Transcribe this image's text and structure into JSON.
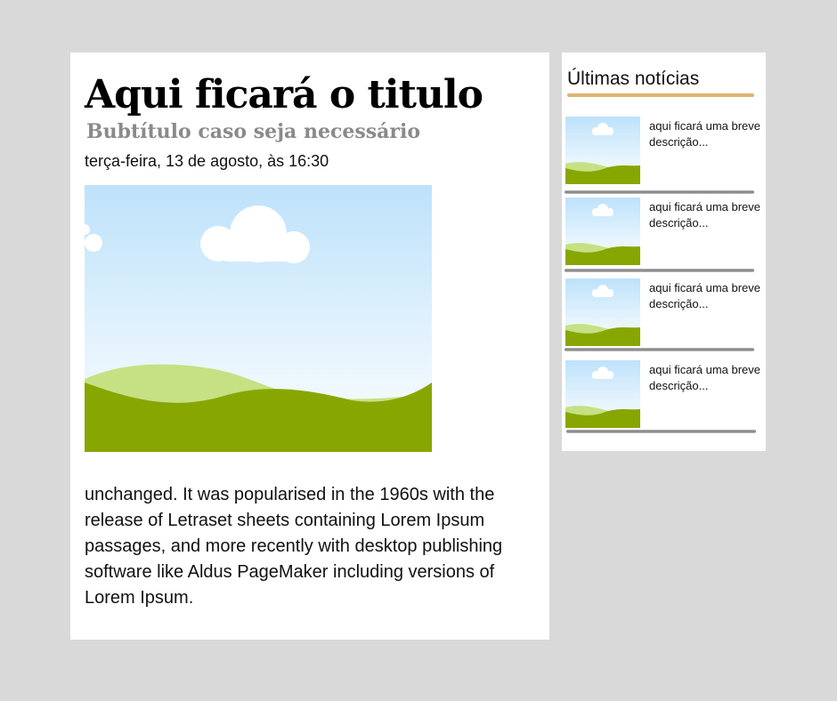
{
  "article": {
    "title": "Aqui ficará o titulo",
    "subtitle": "Bubtítulo caso seja necessário",
    "date": "terça-feira, 13 de agosto, às 16:30",
    "image_icon": "landscape-placeholder-icon",
    "body": "unchanged. It was popularised in the 1960s with the release of Letraset sheets containing Lorem Ipsum passages, and more recently with desktop publishing software like Aldus PageMaker including versions of Lorem Ipsum."
  },
  "sidebar": {
    "title": "Últimas notícias",
    "accent_color": "#d9a758",
    "items": [
      {
        "description": "aqui ficará uma breve descrição...",
        "thumb_icon": "landscape-placeholder-icon"
      },
      {
        "description": "aqui ficará uma breve descrição...",
        "thumb_icon": "landscape-placeholder-icon"
      },
      {
        "description": "aqui ficará uma breve descrição...",
        "thumb_icon": "landscape-placeholder-icon"
      },
      {
        "description": "aqui ficará uma breve descrição...",
        "thumb_icon": "landscape-placeholder-icon"
      }
    ]
  },
  "colors": {
    "page_background": "#d9d9d9",
    "card_background": "#ffffff",
    "sky_top": "#bfe3fa",
    "hill_light": "#c5e184",
    "hill_dark": "#88a600"
  }
}
